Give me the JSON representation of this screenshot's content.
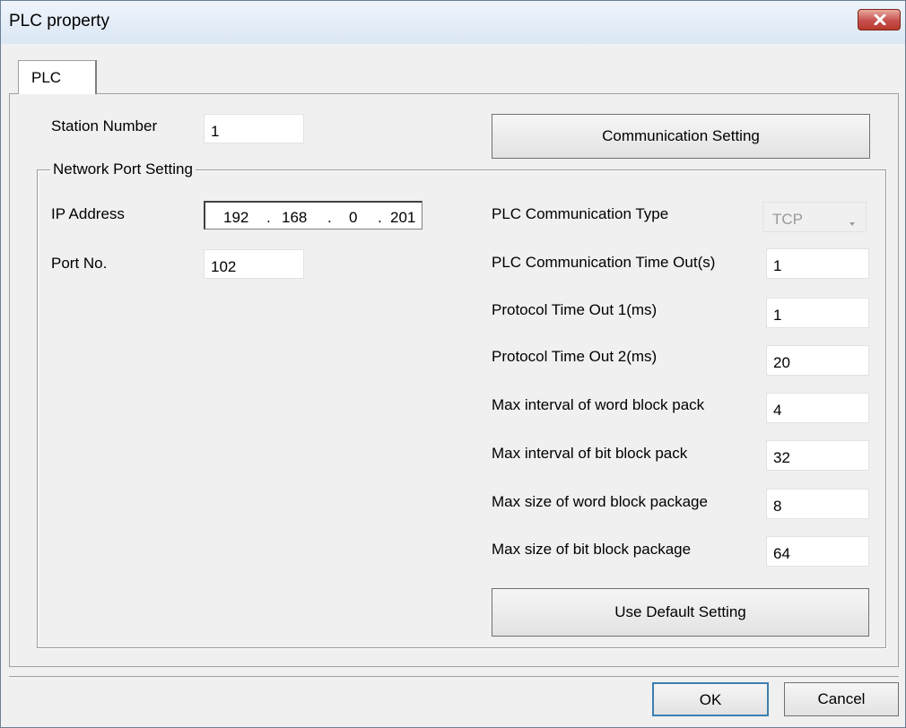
{
  "window": {
    "title": "PLC property"
  },
  "tabs": [
    {
      "label": "PLC"
    }
  ],
  "station": {
    "label": "Station Number",
    "value": "1"
  },
  "comm_setting_button": "Communication Setting",
  "network_group": {
    "title": "Network Port Setting",
    "ip_label": "IP Address",
    "ip": [
      "192",
      "168",
      "0",
      "201"
    ],
    "port_label": "Port No.",
    "port_value": "102"
  },
  "settings": {
    "comm_type_label": "PLC Communication Type",
    "comm_type_value": "TCP",
    "fields": [
      {
        "label": "PLC Communication Time Out(s)",
        "value": "1"
      },
      {
        "label": "Protocol Time Out 1(ms)",
        "value": "1"
      },
      {
        "label": "Protocol Time Out 2(ms)",
        "value": "20"
      },
      {
        "label": "Max interval of word block pack",
        "value": "4"
      },
      {
        "label": "Max interval of bit block pack",
        "value": "32"
      },
      {
        "label": "Max size of word block package",
        "value": "8"
      },
      {
        "label": "Max size of bit block package",
        "value": "64"
      }
    ],
    "default_button": "Use Default Setting"
  },
  "footer": {
    "ok": "OK",
    "cancel": "Cancel"
  },
  "colors": {
    "close_button": "#c75050",
    "disabled_text": "#9a9a9a"
  }
}
